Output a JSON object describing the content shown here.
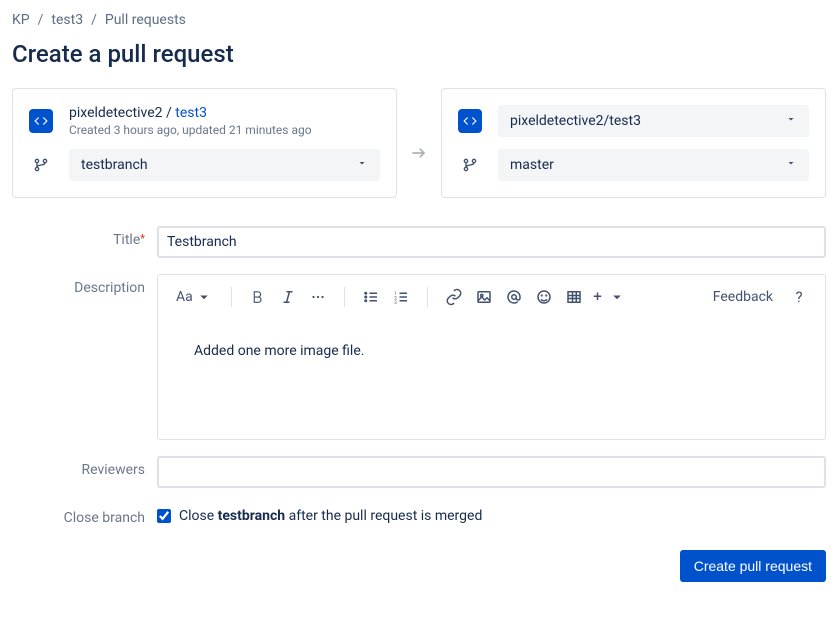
{
  "breadcrumb": {
    "a": "KP",
    "b": "test3",
    "c": "Pull requests"
  },
  "page_title": "Create a pull request",
  "source": {
    "owner": "pixeldetective2",
    "repo": "test3",
    "meta": "Created 3 hours ago, updated 21 minutes ago",
    "branch": "testbranch"
  },
  "dest": {
    "repo_path": "pixeldetective2/test3",
    "branch": "master"
  },
  "labels": {
    "title": "Title",
    "description": "Description",
    "reviewers": "Reviewers",
    "close_branch": "Close branch"
  },
  "form": {
    "title_value": "Testbranch",
    "description_body": "Added one more image file.",
    "close_prefix": "Close ",
    "close_branch": "testbranch",
    "close_suffix": " after the pull request is merged"
  },
  "toolbar": {
    "text_style": "Aa",
    "feedback": "Feedback",
    "help": "?"
  },
  "submit_label": "Create pull request"
}
